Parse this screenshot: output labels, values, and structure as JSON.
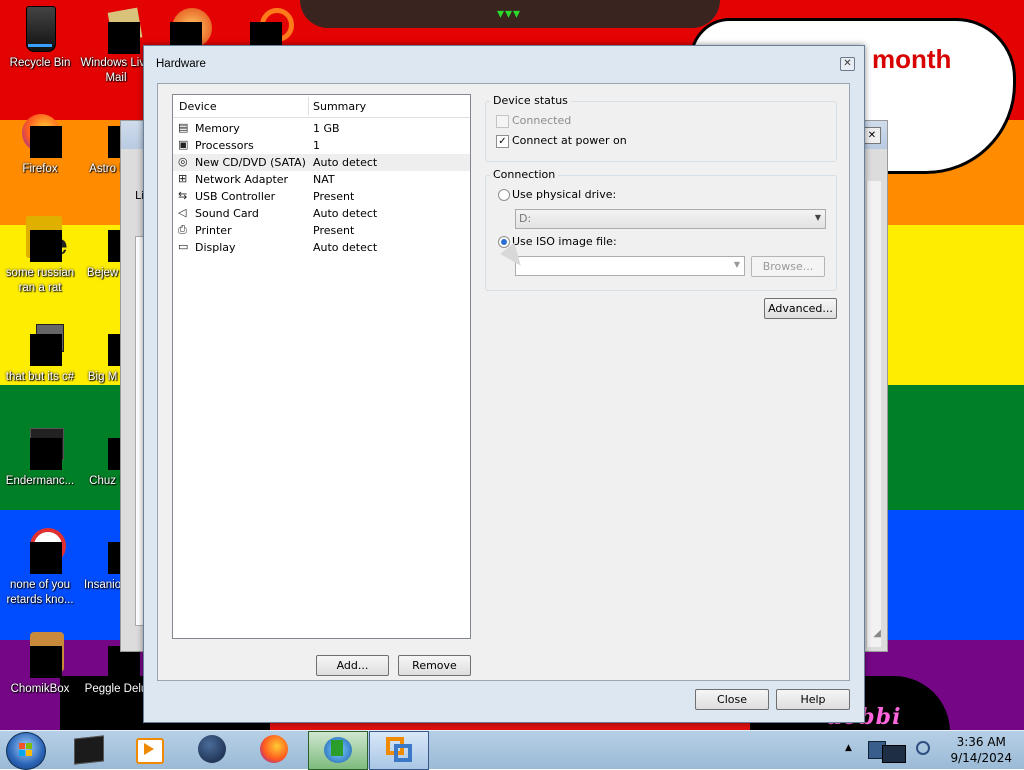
{
  "wallpaper": {
    "stripes": [
      "#e40303",
      "#ff8c00",
      "#ffed00",
      "#008026",
      "#004dff",
      "#750787"
    ],
    "speech_text": "month",
    "bottom_text": "u0bbi"
  },
  "desktop_icons": [
    {
      "label": "Recycle Bin"
    },
    {
      "label": "Windows Live Mail"
    },
    {
      "label": "Firefox"
    },
    {
      "label": "Astro Delu"
    },
    {
      "label": "some russian ran a rat"
    },
    {
      "label": "Bejew Delu"
    },
    {
      "label": "that but its c#"
    },
    {
      "label": "Big M Delu"
    },
    {
      "label": "Endermanc..."
    },
    {
      "label": "Chuz Delu"
    },
    {
      "label": "none of you retards kno..."
    },
    {
      "label": "Insanio Delu"
    },
    {
      "label": "ChomikBox"
    },
    {
      "label": "Peggle Delu"
    }
  ],
  "background_window": {
    "partial_label": "Li"
  },
  "dialog": {
    "title": "Hardware",
    "close_glyph": "✕",
    "device_list": {
      "columns": [
        "Device",
        "Summary"
      ],
      "rows": [
        {
          "icon": "memory-icon",
          "glyph": "▤",
          "device": "Memory",
          "summary": "1 GB"
        },
        {
          "icon": "processor-icon",
          "glyph": "▣",
          "device": "Processors",
          "summary": "1"
        },
        {
          "icon": "cd-dvd-icon",
          "glyph": "◎",
          "device": "New CD/DVD (SATA)",
          "summary": "Auto detect",
          "selected": true
        },
        {
          "icon": "network-adapter-icon",
          "glyph": "⊞",
          "device": "Network Adapter",
          "summary": "NAT"
        },
        {
          "icon": "usb-icon",
          "glyph": "⇆",
          "device": "USB Controller",
          "summary": "Present"
        },
        {
          "icon": "sound-icon",
          "glyph": "◁",
          "device": "Sound Card",
          "summary": "Auto detect"
        },
        {
          "icon": "printer-icon",
          "glyph": "⎙",
          "device": "Printer",
          "summary": "Present"
        },
        {
          "icon": "display-icon",
          "glyph": "▭",
          "device": "Display",
          "summary": "Auto detect"
        }
      ]
    },
    "add_button": "Add...",
    "remove_button": "Remove",
    "device_status": {
      "title": "Device status",
      "connected_label": "Connected",
      "connected_checked": false,
      "connected_disabled": true,
      "power_label": "Connect at power on",
      "power_checked": true
    },
    "connection": {
      "title": "Connection",
      "physical_label": "Use physical drive:",
      "physical_selected": false,
      "drive_value": "D:",
      "iso_label": "Use ISO image file:",
      "iso_selected": true,
      "iso_value": "",
      "browse_button": "Browse..."
    },
    "advanced_button": "Advanced...",
    "close_button": "Close",
    "help_button": "Help"
  },
  "taskbar": {
    "time": "3:36 AM",
    "date": "9/14/2024"
  }
}
